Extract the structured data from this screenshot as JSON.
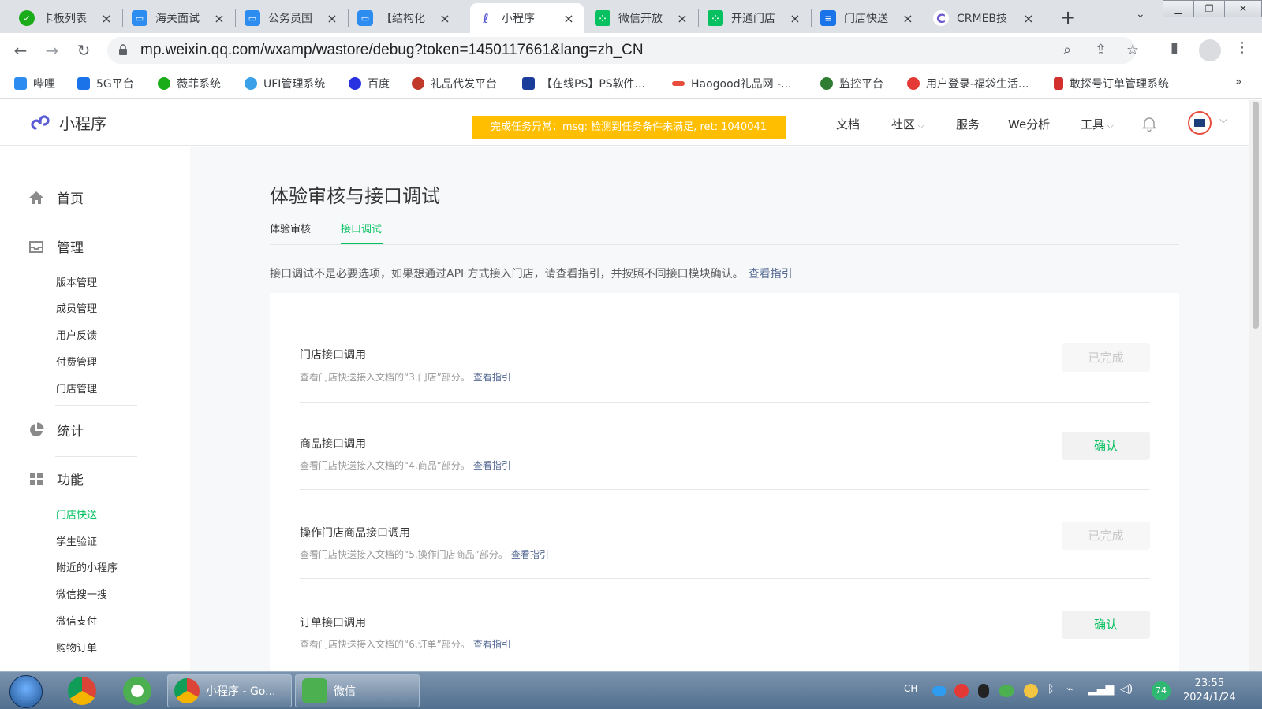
{
  "browser": {
    "tabs": [
      {
        "title": "卡板列表",
        "color": "#1aad19"
      },
      {
        "title": "海关面试",
        "color": "#2d8cf0"
      },
      {
        "title": "公务员国",
        "color": "#2d8cf0"
      },
      {
        "title": "【结构化",
        "color": "#2d8cf0"
      },
      {
        "title": "小程序",
        "color": "#5b5bd6"
      },
      {
        "title": "微信开放",
        "color": "#07c160"
      },
      {
        "title": "开通门店",
        "color": "#07c160"
      },
      {
        "title": "门店快送",
        "color": "#1a73e8"
      },
      {
        "title": "CRMEB技",
        "color": "#6a5acd"
      }
    ],
    "url": "mp.weixin.qq.com/wxamp/wastore/debug?token=1450117661&lang=zh_CN",
    "bookmarks": [
      {
        "label": "哔哩",
        "color": "#2d8cf0"
      },
      {
        "label": "5G平台",
        "color": "#1a73e8"
      },
      {
        "label": "薇菲系统",
        "color": "#1aad19"
      },
      {
        "label": "UFI管理系统",
        "color": "#3aa0e8"
      },
      {
        "label": "百度",
        "color": "#2932e1"
      },
      {
        "label": "礼品代发平台",
        "color": "#c0392b"
      },
      {
        "label": "【在线PS】PS软件...",
        "color": "#1a3d9c"
      },
      {
        "label": "Haogood礼品网 -...",
        "color": "#e74c3c"
      },
      {
        "label": "监控平台",
        "color": "#2e7d32"
      },
      {
        "label": "用户登录-福袋生活...",
        "color": "#e53935"
      },
      {
        "label": "敢探号订单管理系统",
        "color": "#d32f2f"
      }
    ],
    "bookmarks_more": "»"
  },
  "header": {
    "logo_text": "小程序",
    "alert": "完成任务异常：msg: 检测到任务条件未满足, ret: 1040041",
    "nav": [
      "文档",
      "社区",
      "服务",
      "We分析",
      "工具"
    ]
  },
  "sidebar": {
    "groups": [
      {
        "label": "首页",
        "icon": "home-icon"
      },
      {
        "label": "管理",
        "icon": "inbox-icon"
      },
      {
        "label": "统计",
        "icon": "pie-chart-icon"
      },
      {
        "label": "功能",
        "icon": "grid-icon"
      }
    ],
    "manage_items": [
      "版本管理",
      "成员管理",
      "用户反馈",
      "付费管理",
      "门店管理"
    ],
    "feature_items": [
      "门店快送",
      "学生验证",
      "附近的小程序",
      "微信搜一搜",
      "微信支付",
      "购物订单"
    ],
    "active_item": "门店快送"
  },
  "main": {
    "title": "体验审核与接口调试",
    "tabs": [
      "体验审核",
      "接口调试"
    ],
    "active_tab": "接口调试",
    "intro": "接口调试不是必要选项，如果想通过API 方式接入门店，请查看指引，并按照不同接口模块确认。",
    "intro_link": "查看指引",
    "rows": [
      {
        "title": "门店接口调用",
        "desc": "查看门店快送接入文档的“3.门店”部分。",
        "link": "查看指引",
        "button": "已完成",
        "status": "done"
      },
      {
        "title": "商品接口调用",
        "desc": "查看门店快送接入文档的“4.商品”部分。",
        "link": "查看指引",
        "button": "确认",
        "status": "confirm"
      },
      {
        "title": "操作门店商品接口调用",
        "desc": "查看门店快送接入文档的“5.操作门店商品”部分。",
        "link": "查看指引",
        "button": "已完成",
        "status": "done"
      },
      {
        "title": "订单接口调用",
        "desc": "查看门店快送接入文档的“6.订单”部分。",
        "link": "查看指引",
        "button": "确认",
        "status": "confirm"
      }
    ]
  },
  "taskbar": {
    "tasks": [
      {
        "label": "小程序 - Go..."
      },
      {
        "label": "微信"
      }
    ],
    "ime": "CH",
    "battery": "74",
    "time": "23:55",
    "date": "2024/1/24"
  }
}
